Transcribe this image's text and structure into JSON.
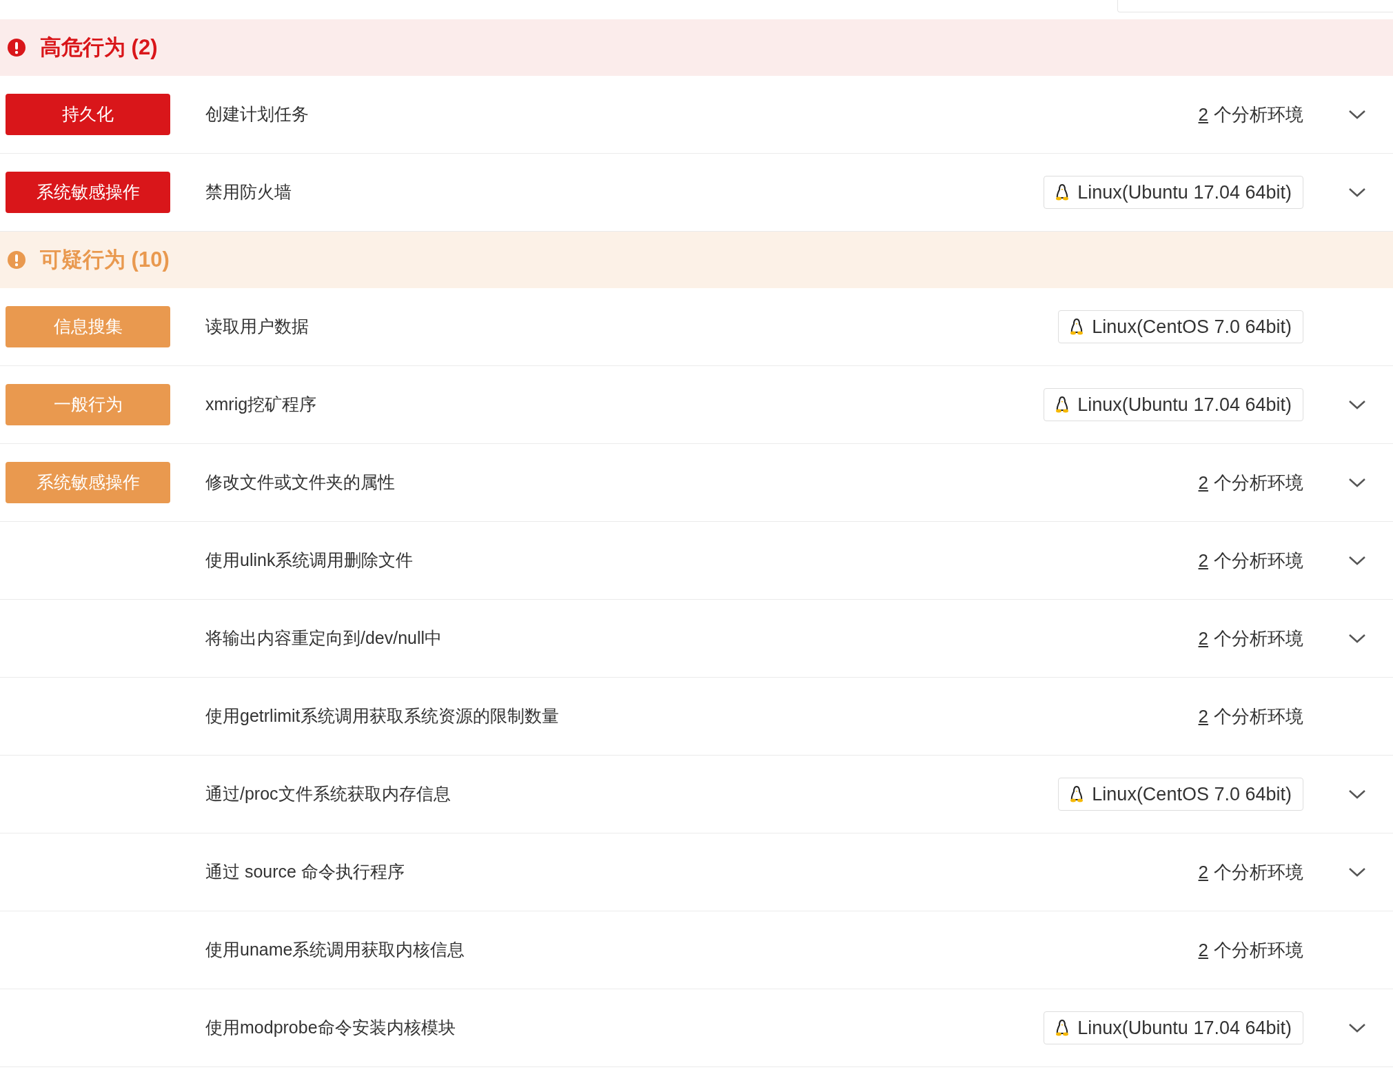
{
  "sections": [
    {
      "kind": "high",
      "title": "高危行为 (2)",
      "items": [
        {
          "tag": "持久化",
          "name": "创建计划任务",
          "env": {
            "kind": "count",
            "count": "2",
            "text": "个分析环境"
          },
          "expandable": true
        },
        {
          "tag": "系统敏感操作",
          "name": "禁用防火墙",
          "env": {
            "kind": "os",
            "label": "Linux(Ubuntu 17.04 64bit)"
          },
          "expandable": true
        }
      ]
    },
    {
      "kind": "medium",
      "title": "可疑行为 (10)",
      "items": [
        {
          "tag": "信息搜集",
          "name": "读取用户数据",
          "env": {
            "kind": "os",
            "label": "Linux(CentOS 7.0 64bit)"
          },
          "expandable": false
        },
        {
          "tag": "一般行为",
          "name": "xmrig挖矿程序",
          "env": {
            "kind": "os",
            "label": "Linux(Ubuntu 17.04 64bit)"
          },
          "expandable": true
        },
        {
          "tag": "系统敏感操作",
          "name": "修改文件或文件夹的属性",
          "env": {
            "kind": "count",
            "count": "2",
            "text": "个分析环境"
          },
          "expandable": true
        },
        {
          "name": "使用ulink系统调用删除文件",
          "env": {
            "kind": "count",
            "count": "2",
            "text": "个分析环境"
          },
          "expandable": true
        },
        {
          "name": "将输出内容重定向到/dev/null中",
          "env": {
            "kind": "count",
            "count": "2",
            "text": "个分析环境"
          },
          "expandable": true
        },
        {
          "name": "使用getrlimit系统调用获取系统资源的限制数量",
          "env": {
            "kind": "count",
            "count": "2",
            "text": "个分析环境"
          },
          "expandable": false
        },
        {
          "name": "通过/proc文件系统获取内存信息",
          "env": {
            "kind": "os",
            "label": "Linux(CentOS 7.0 64bit)"
          },
          "expandable": true
        },
        {
          "name": "通过 source 命令执行程序",
          "env": {
            "kind": "count",
            "count": "2",
            "text": "个分析环境"
          },
          "expandable": true
        },
        {
          "name": "使用uname系统调用获取内核信息",
          "env": {
            "kind": "count",
            "count": "2",
            "text": "个分析环境"
          },
          "expandable": false
        },
        {
          "name": "使用modprobe命令安装内核模块",
          "env": {
            "kind": "os",
            "label": "Linux(Ubuntu 17.04 64bit)"
          },
          "expandable": true
        }
      ]
    }
  ]
}
